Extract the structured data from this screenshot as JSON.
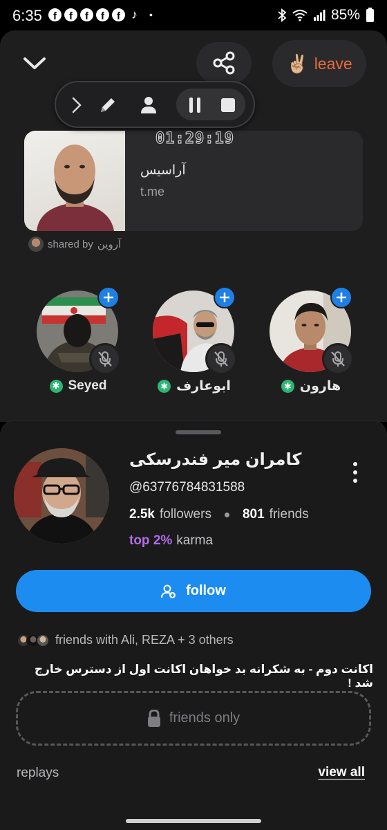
{
  "status_bar": {
    "time": "6:35",
    "notification_icons": [
      "facebook-icon",
      "facebook-icon",
      "facebook-icon",
      "facebook-icon",
      "facebook-icon",
      "tiktok-icon"
    ],
    "battery": "85%"
  },
  "room": {
    "leave_label": "leave",
    "leave_emoji": "✌🏼",
    "timer": "01:29:19",
    "link_card": {
      "title": "آراسیس",
      "domain": "t.me"
    },
    "shared_by": {
      "prefix": "shared by",
      "name": "آروین"
    },
    "speakers": [
      {
        "name": "Seyed"
      },
      {
        "name": "ابوعارف"
      },
      {
        "name": "هارون"
      }
    ]
  },
  "profile": {
    "name": "کامران میر فندرسکی",
    "handle": "@63776784831588",
    "followers_count": "2.5k",
    "followers_label": "followers",
    "friends_count": "801",
    "friends_label": "friends",
    "karma_rank": "top 2%",
    "karma_label": "karma",
    "follow_label": "follow",
    "mutual_friends": "friends with Ali, REZA + 3 others",
    "bio": "اکانت دوم - به شکرانه بد  خواهان اکانت اول از دسترس خارج شد !",
    "locked_label": "friends only",
    "replays_label": "replays",
    "view_all_label": "view all"
  },
  "colors": {
    "accent_blue": "#1d8cf0",
    "leave_orange": "#e76a3c",
    "karma_purple": "#b26be8",
    "online_green": "#2cb673"
  }
}
